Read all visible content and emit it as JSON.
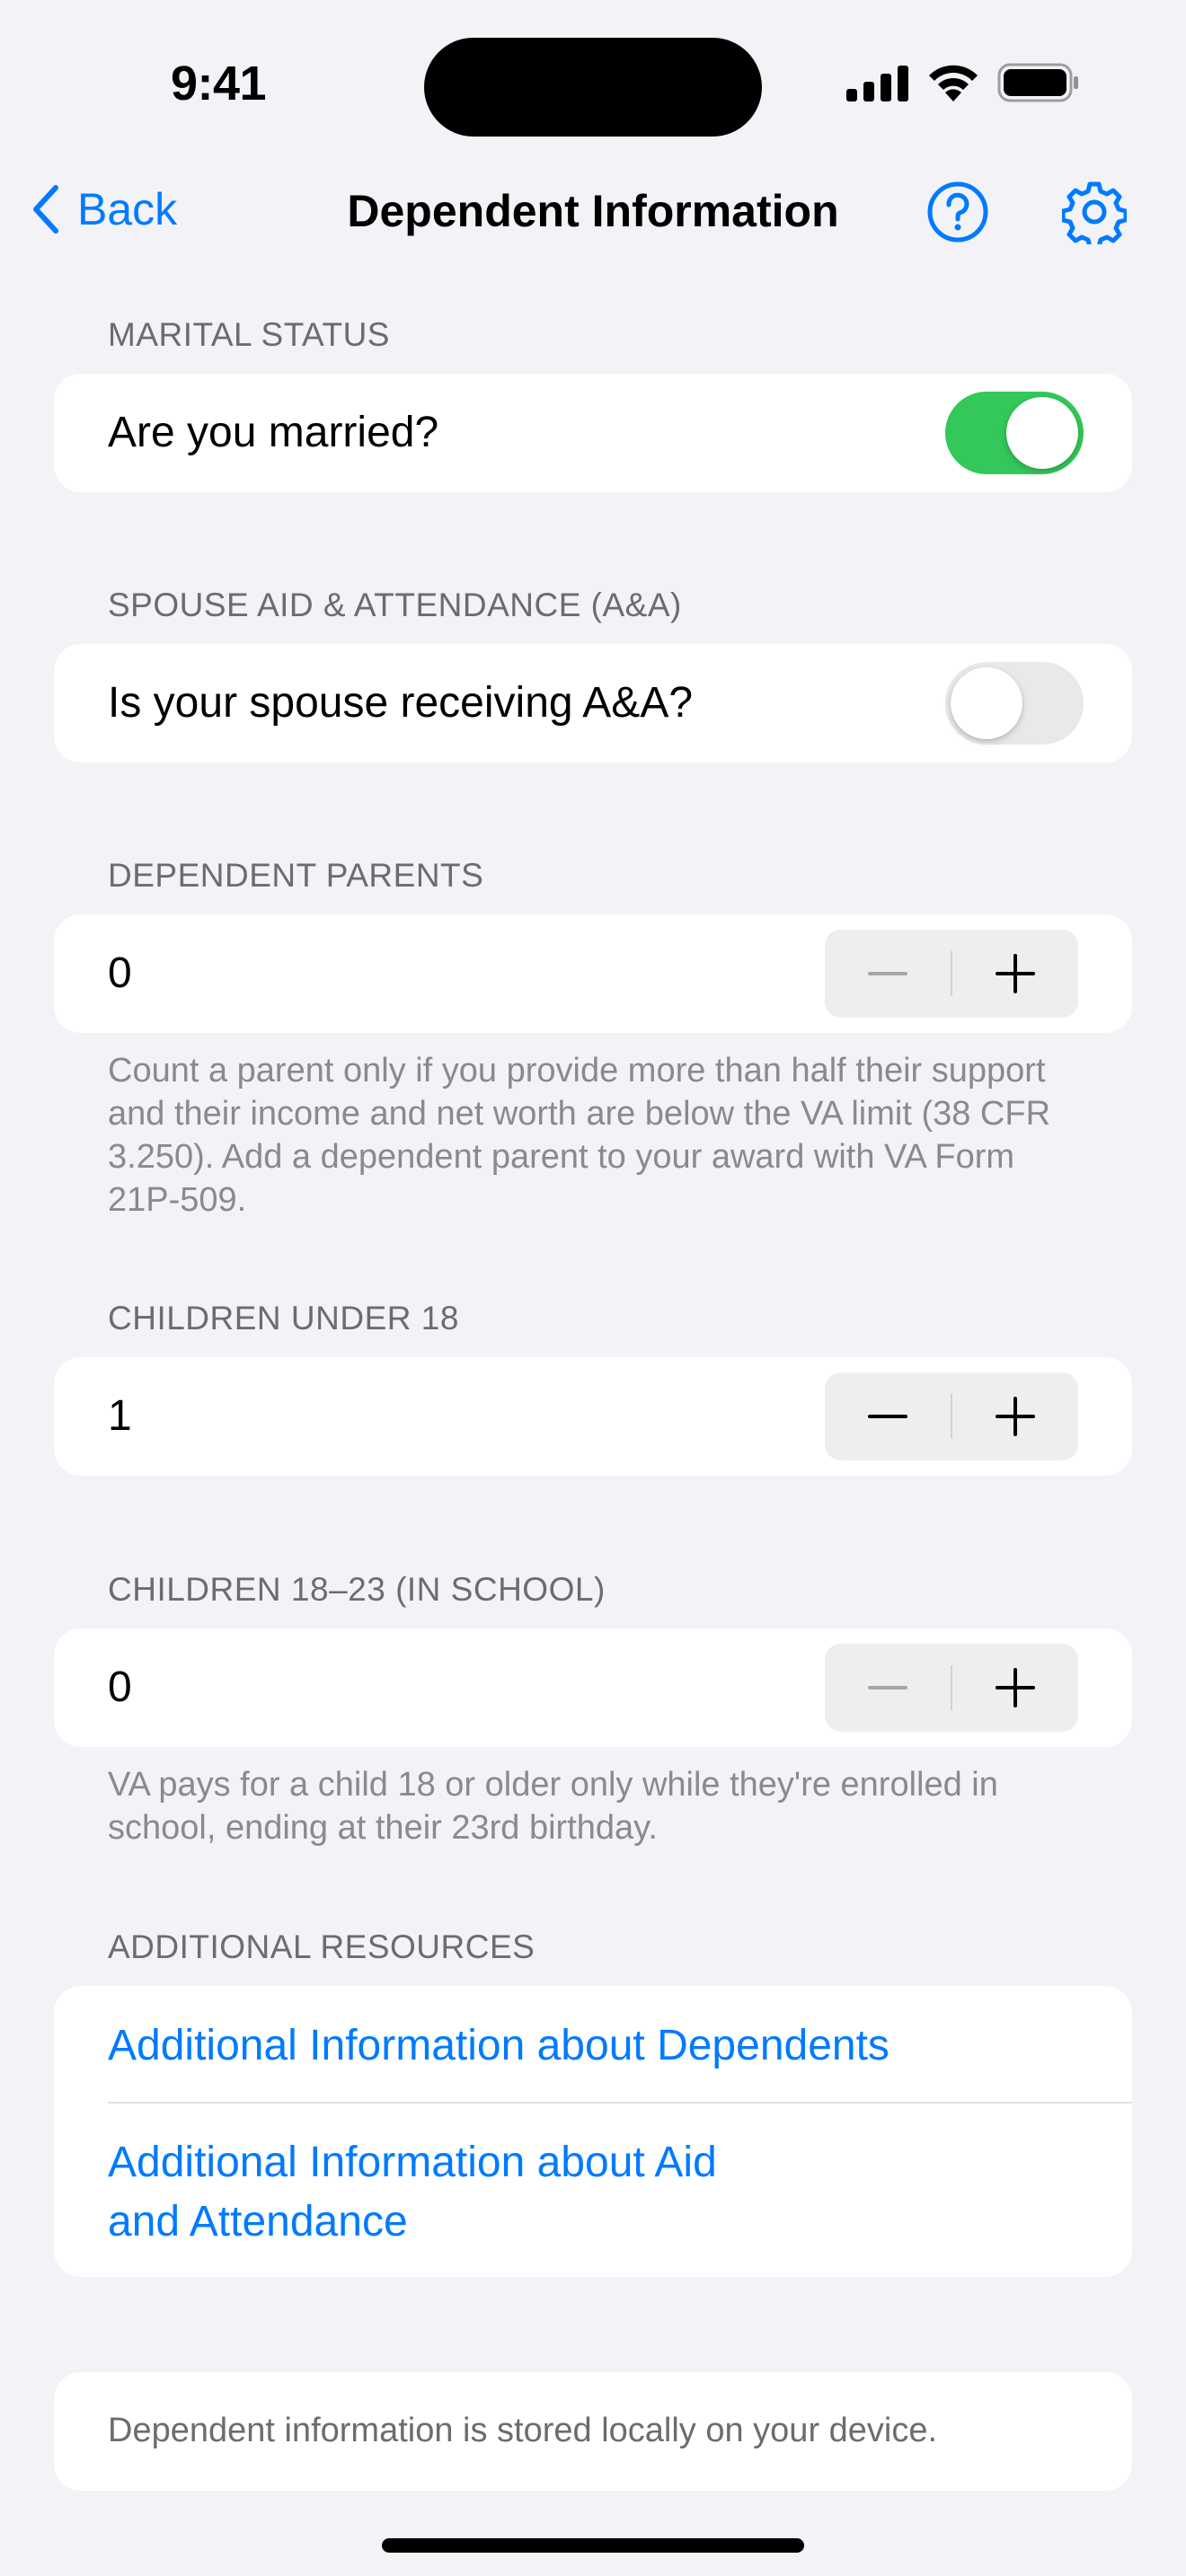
{
  "status_bar": {
    "time": "9:41"
  },
  "nav": {
    "back_label": "Back",
    "title": "Dependent Information",
    "help_icon": "question-circle-icon",
    "settings_icon": "gear-icon",
    "accent_color": "#007AFF"
  },
  "marital_status": {
    "header": "MARITAL STATUS",
    "label": "Are you married?",
    "value": true
  },
  "spouse_aa": {
    "header": "SPOUSE AID & ATTENDANCE (A&A)",
    "label": "Is your spouse receiving A&A?",
    "value": false
  },
  "dependent_parents": {
    "header": "DEPENDENT PARENTS",
    "value": "0",
    "footnote": "Count a parent only if you provide more than half their support and their income and net worth are below the VA limit (38 CFR 3.250). Add a dependent parent to your award with VA Form 21P-509."
  },
  "children_under_18": {
    "header": "CHILDREN UNDER 18",
    "value": "1"
  },
  "children_18_23": {
    "header": "CHILDREN 18–23 (IN SCHOOL)",
    "value": "0",
    "footnote": "VA pays for a child 18 or older only while they're enrolled in school, ending at their 23rd birthday."
  },
  "additional_resources": {
    "header": "ADDITIONAL RESOURCES",
    "links": [
      {
        "label": "Additional Information about Dependents"
      },
      {
        "label_line1": "Additional Information about Aid",
        "label_line2": "and Attendance"
      }
    ]
  },
  "footer": {
    "text": "Dependent information is stored locally on your device."
  },
  "colors": {
    "background": "#F2F2F7",
    "toggle_on": "#34C759",
    "toggle_off": "#E9E9EB",
    "link": "#007AFF"
  }
}
